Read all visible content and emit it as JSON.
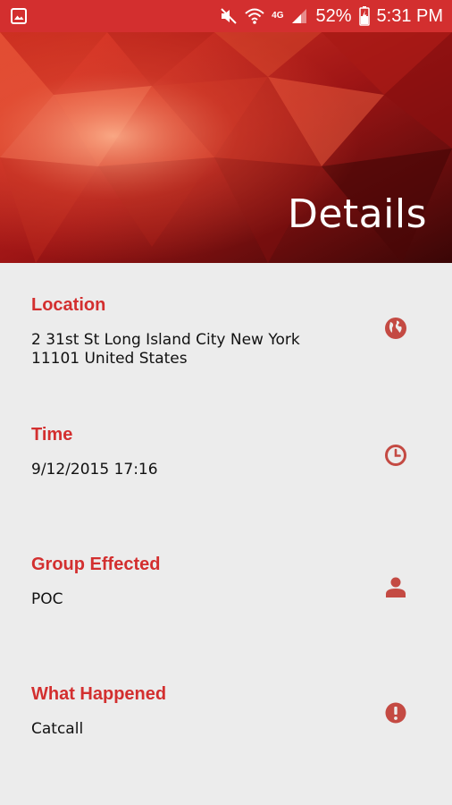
{
  "status_bar": {
    "battery": "52%",
    "time": "5:31 PM",
    "network": "4G",
    "icons": [
      "image-icon",
      "mute-icon",
      "wifi-icon",
      "signal-icon",
      "battery-charging-icon"
    ]
  },
  "header": {
    "title": "Details"
  },
  "colors": {
    "accent": "#d32f2f",
    "icon": "#c44a43",
    "background": "#ececec"
  },
  "sections": [
    {
      "label": "Location",
      "value": "2 31st St Long Island City New York\n11101 United States",
      "icon": "globe-icon"
    },
    {
      "label": "Time",
      "value": "9/12/2015  17:16",
      "icon": "clock-icon"
    },
    {
      "label": "Group Effected",
      "value": "POC",
      "icon": "person-icon"
    },
    {
      "label": "What Happened",
      "value": "Catcall",
      "icon": "alert-icon"
    }
  ]
}
